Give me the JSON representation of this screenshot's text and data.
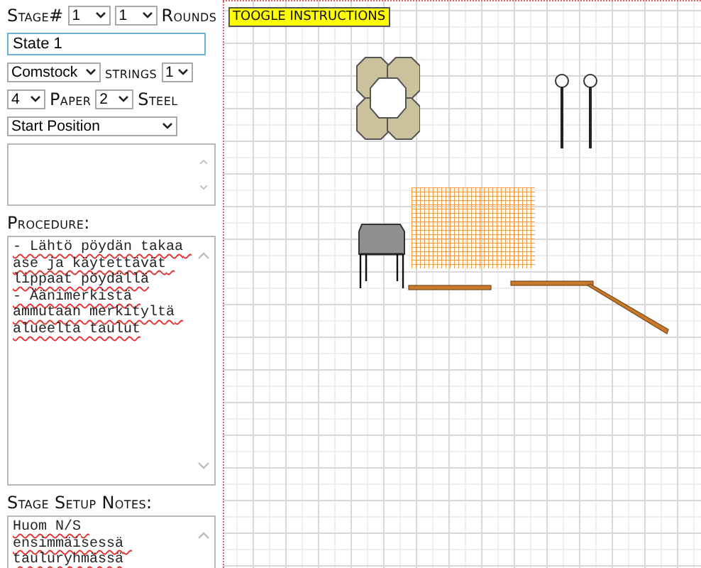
{
  "stage_row": {
    "label": "Stage#",
    "stage": "1",
    "round": "1",
    "rounds_label": "Rounds"
  },
  "stage_name": {
    "value": "State 1"
  },
  "target_row": {
    "target": "Comstock",
    "strings_label": "strings",
    "strings": "1"
  },
  "paper_row": {
    "paper": "4",
    "paper_label": "Paper",
    "steel": "2",
    "steel_label": "Steel"
  },
  "position": {
    "value": "Start Position"
  },
  "procedure": {
    "label": "Procedure:",
    "value": "- Lähtö pöydän takaa ase ja käytettävät lippaat pöydällä\n- Äänimerkistä ammutaan merkityltä alueelta taulut"
  },
  "setup_notes": {
    "label": "Stage Setup Notes:",
    "value": "Huom N/S ensimmäisessä tauluryhmässä"
  },
  "toggle_button": {
    "label": "TOOGLE INSTRUCTIONS"
  }
}
